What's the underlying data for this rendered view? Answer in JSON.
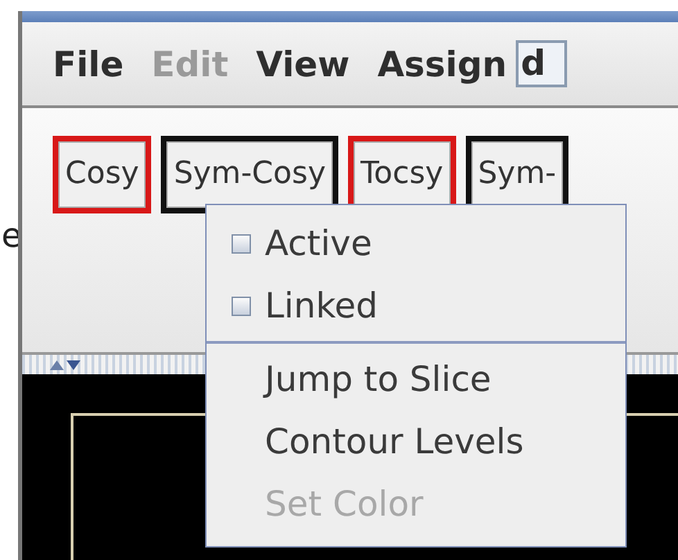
{
  "left_fragment": "e",
  "menu": [
    {
      "label": "File",
      "disabled": false
    },
    {
      "label": "Edit",
      "disabled": true
    },
    {
      "label": "View",
      "disabled": false
    },
    {
      "label": "Assign",
      "disabled": false
    }
  ],
  "menu_field": "d",
  "spectra": [
    {
      "label": "Cosy",
      "selected": true
    },
    {
      "label": "Sym-Cosy",
      "selected": false
    },
    {
      "label": "Tocsy",
      "selected": true
    },
    {
      "label": "Sym-",
      "selected": false
    }
  ],
  "context_menu": {
    "items": [
      {
        "kind": "check",
        "label": "Active",
        "checked": false,
        "disabled": false
      },
      {
        "kind": "check",
        "label": "Linked",
        "checked": false,
        "disabled": false
      },
      {
        "kind": "separator"
      },
      {
        "kind": "action",
        "label": "Jump to Slice",
        "disabled": false
      },
      {
        "kind": "action",
        "label": "Contour Levels",
        "disabled": false
      },
      {
        "kind": "action",
        "label": "Set Color",
        "disabled": true
      }
    ]
  }
}
